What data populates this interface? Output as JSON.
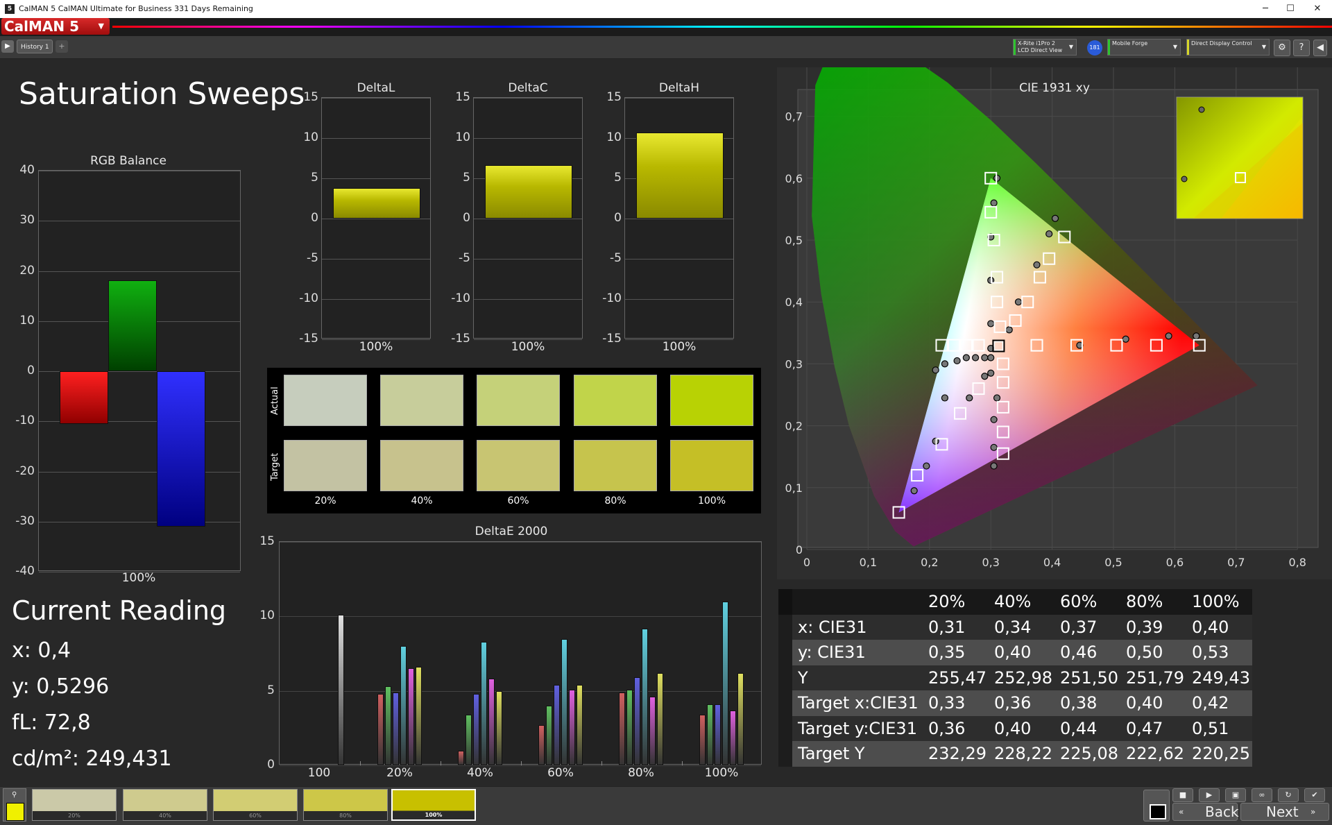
{
  "window": {
    "title": "CalMAN 5 CalMAN Ultimate for Business 331 Days Remaining",
    "logo": "CalMAN 5",
    "icon_text": "5"
  },
  "toolbar": {
    "history_tab": "History 1",
    "meter": {
      "line1": "X-Rite i1Pro 2",
      "line2": "LCD Direct View",
      "color": "#2fc52f"
    },
    "badge": "181",
    "source": {
      "line1": "Mobile Forge",
      "color": "#2fc52f"
    },
    "display": {
      "line1": "Direct Display Control",
      "color": "#d8d82a"
    }
  },
  "page": {
    "title": "Saturation Sweeps"
  },
  "rgb_balance": {
    "title": "RGB Balance",
    "yticks": [
      "40",
      "30",
      "20",
      "10",
      "0",
      "-10",
      "-20",
      "-30",
      "-40"
    ],
    "xlabel": "100%"
  },
  "delta_charts": [
    {
      "title": "DeltaL",
      "value": 3.8,
      "xlabel": "100%"
    },
    {
      "title": "DeltaC",
      "value": 6.6,
      "xlabel": "100%"
    },
    {
      "title": "DeltaH",
      "value": 10.7,
      "xlabel": "100%"
    }
  ],
  "delta_yticks": [
    "15",
    "10",
    "5",
    "0",
    "-5",
    "-10",
    "-15"
  ],
  "swatches": {
    "actual_label": "Actual",
    "target_label": "Target",
    "labels": [
      "20%",
      "40%",
      "60%",
      "80%",
      "100%"
    ],
    "actual_colors": [
      "#c6cdbd",
      "#c7cd9b",
      "#c5d179",
      "#c1d44a",
      "#b8d204"
    ],
    "target_colors": [
      "#c3c2a3",
      "#c7c28d",
      "#c8c572",
      "#c6c44d",
      "#c5bf26"
    ]
  },
  "deltae": {
    "title": "DeltaE 2000",
    "yticks": [
      "15",
      "10",
      "5",
      "0"
    ],
    "groups": [
      "100",
      "20%",
      "40%",
      "60%",
      "80%",
      "100%"
    ],
    "bar_colors": [
      "#e0e0e0",
      "#d06060",
      "#60c060",
      "#6060e0",
      "#60d0e0",
      "#e060e0",
      "#e0e060"
    ]
  },
  "current_reading": {
    "heading": "Current Reading",
    "x": "x: 0,4",
    "y": "y: 0,5296",
    "fl": "fL: 72,8",
    "cdm2": "cd/m²: 249,431"
  },
  "cie": {
    "title": "CIE 1931 xy",
    "xticks": [
      "0",
      "0,1",
      "0,2",
      "0,3",
      "0,4",
      "0,5",
      "0,6",
      "0,7",
      "0,8"
    ],
    "yticks": [
      "0,8",
      "0,7",
      "0,6",
      "0,5",
      "0,4",
      "0,3",
      "0,2",
      "0,1",
      "0"
    ]
  },
  "table": {
    "headers": [
      "20%",
      "40%",
      "60%",
      "80%",
      "100%"
    ],
    "rows": [
      {
        "label": "x: CIE31",
        "values": [
          "0,31",
          "0,34",
          "0,37",
          "0,39",
          "0,40"
        ]
      },
      {
        "label": "y: CIE31",
        "values": [
          "0,35",
          "0,40",
          "0,46",
          "0,50",
          "0,53"
        ]
      },
      {
        "label": "Y",
        "values": [
          "255,47",
          "252,98",
          "251,50",
          "251,79",
          "249,43"
        ]
      },
      {
        "label": "Target x:CIE31",
        "values": [
          "0,33",
          "0,36",
          "0,38",
          "0,40",
          "0,42"
        ]
      },
      {
        "label": "Target y:CIE31",
        "values": [
          "0,36",
          "0,40",
          "0,44",
          "0,47",
          "0,51"
        ]
      },
      {
        "label": "Target Y",
        "values": [
          "232,29",
          "228,22",
          "225,08",
          "222,62",
          "220,25"
        ]
      }
    ]
  },
  "bottom": {
    "swatches": [
      {
        "label": "20%",
        "color": "#cbc9a8"
      },
      {
        "label": "40%",
        "color": "#cfcb8e"
      },
      {
        "label": "60%",
        "color": "#d2cd73"
      },
      {
        "label": "80%",
        "color": "#cdc748"
      },
      {
        "label": "100%",
        "color": "#c8c000"
      }
    ],
    "back": "Back",
    "next": "Next"
  },
  "chart_data": [
    {
      "type": "bar",
      "title": "RGB Balance",
      "categories": [
        "100%"
      ],
      "series": [
        {
          "values": [
            -10.5
          ],
          "color": "#ff0000"
        },
        {
          "values": [
            18.2
          ],
          "color": "#00a000"
        },
        {
          "values": [
            -31
          ],
          "color": "#0000ff"
        }
      ],
      "ylim": [
        -40,
        40
      ]
    },
    {
      "type": "bar",
      "title": "DeltaL",
      "categories": [
        "100%"
      ],
      "values": [
        3.8
      ],
      "ylim": [
        -15,
        15
      ]
    },
    {
      "type": "bar",
      "title": "DeltaC",
      "categories": [
        "100%"
      ],
      "values": [
        6.6
      ],
      "ylim": [
        -15,
        15
      ]
    },
    {
      "type": "bar",
      "title": "DeltaH",
      "categories": [
        "100%"
      ],
      "values": [
        10.7
      ],
      "ylim": [
        -15,
        15
      ]
    },
    {
      "type": "bar",
      "title": "DeltaE 2000",
      "categories": [
        "100",
        "20%",
        "40%",
        "60%",
        "80%",
        "100%"
      ],
      "series": [
        {
          "values": [
            10.1,
            0,
            0,
            0,
            0,
            0
          ]
        },
        {
          "values": [
            0,
            4.8,
            1.0,
            2.7,
            4.9,
            3.4
          ]
        },
        {
          "values": [
            0,
            5.3,
            3.4,
            4.0,
            5.1,
            4.1
          ]
        },
        {
          "values": [
            0,
            4.9,
            4.8,
            5.4,
            5.9,
            4.1
          ]
        },
        {
          "values": [
            0,
            8.0,
            8.3,
            8.5,
            9.2,
            11.0
          ]
        },
        {
          "values": [
            0,
            6.5,
            5.8,
            5.1,
            4.6,
            3.7
          ]
        },
        {
          "values": [
            0,
            6.6,
            5.0,
            5.4,
            6.2,
            6.2
          ]
        }
      ],
      "ylim": [
        0,
        15
      ]
    },
    {
      "type": "scatter",
      "title": "CIE 1931 xy",
      "xlim": [
        0,
        0.8
      ],
      "ylim": [
        0,
        0.85
      ],
      "gamut": [
        [
          0.64,
          0.33
        ],
        [
          0.3,
          0.6
        ],
        [
          0.15,
          0.06
        ]
      ],
      "targets": [
        [
          0.15,
          0.06
        ],
        [
          0.18,
          0.12
        ],
        [
          0.22,
          0.17
        ],
        [
          0.25,
          0.22
        ],
        [
          0.28,
          0.26
        ],
        [
          0.3,
          0.6
        ],
        [
          0.3,
          0.545
        ],
        [
          0.305,
          0.5
        ],
        [
          0.31,
          0.44
        ],
        [
          0.31,
          0.4
        ],
        [
          0.315,
          0.36
        ],
        [
          0.32,
          0.3
        ],
        [
          0.32,
          0.27
        ],
        [
          0.32,
          0.23
        ],
        [
          0.32,
          0.19
        ],
        [
          0.32,
          0.155
        ],
        [
          0.42,
          0.505
        ],
        [
          0.395,
          0.47
        ],
        [
          0.38,
          0.44
        ],
        [
          0.36,
          0.4
        ],
        [
          0.34,
          0.37
        ],
        [
          0.22,
          0.33
        ],
        [
          0.24,
          0.33
        ],
        [
          0.26,
          0.33
        ],
        [
          0.28,
          0.33
        ],
        [
          0.375,
          0.33
        ],
        [
          0.44,
          0.33
        ],
        [
          0.505,
          0.33
        ],
        [
          0.57,
          0.33
        ],
        [
          0.64,
          0.33
        ],
        [
          0.3127,
          0.329
        ]
      ],
      "measured": [
        [
          0.175,
          0.095
        ],
        [
          0.195,
          0.135
        ],
        [
          0.21,
          0.175
        ],
        [
          0.225,
          0.245
        ],
        [
          0.21,
          0.29
        ],
        [
          0.225,
          0.3
        ],
        [
          0.245,
          0.305
        ],
        [
          0.26,
          0.31
        ],
        [
          0.275,
          0.31
        ],
        [
          0.29,
          0.31
        ],
        [
          0.3,
          0.31
        ],
        [
          0.31,
          0.6
        ],
        [
          0.305,
          0.56
        ],
        [
          0.3,
          0.505
        ],
        [
          0.3,
          0.435
        ],
        [
          0.3,
          0.365
        ],
        [
          0.3,
          0.325
        ],
        [
          0.3,
          0.285
        ],
        [
          0.31,
          0.245
        ],
        [
          0.305,
          0.21
        ],
        [
          0.305,
          0.165
        ],
        [
          0.305,
          0.135
        ],
        [
          0.405,
          0.535
        ],
        [
          0.395,
          0.51
        ],
        [
          0.375,
          0.46
        ],
        [
          0.345,
          0.4
        ],
        [
          0.33,
          0.355
        ],
        [
          0.445,
          0.33
        ],
        [
          0.52,
          0.34
        ],
        [
          0.59,
          0.345
        ],
        [
          0.635,
          0.345
        ],
        [
          0.265,
          0.245
        ],
        [
          0.29,
          0.28
        ]
      ]
    }
  ]
}
